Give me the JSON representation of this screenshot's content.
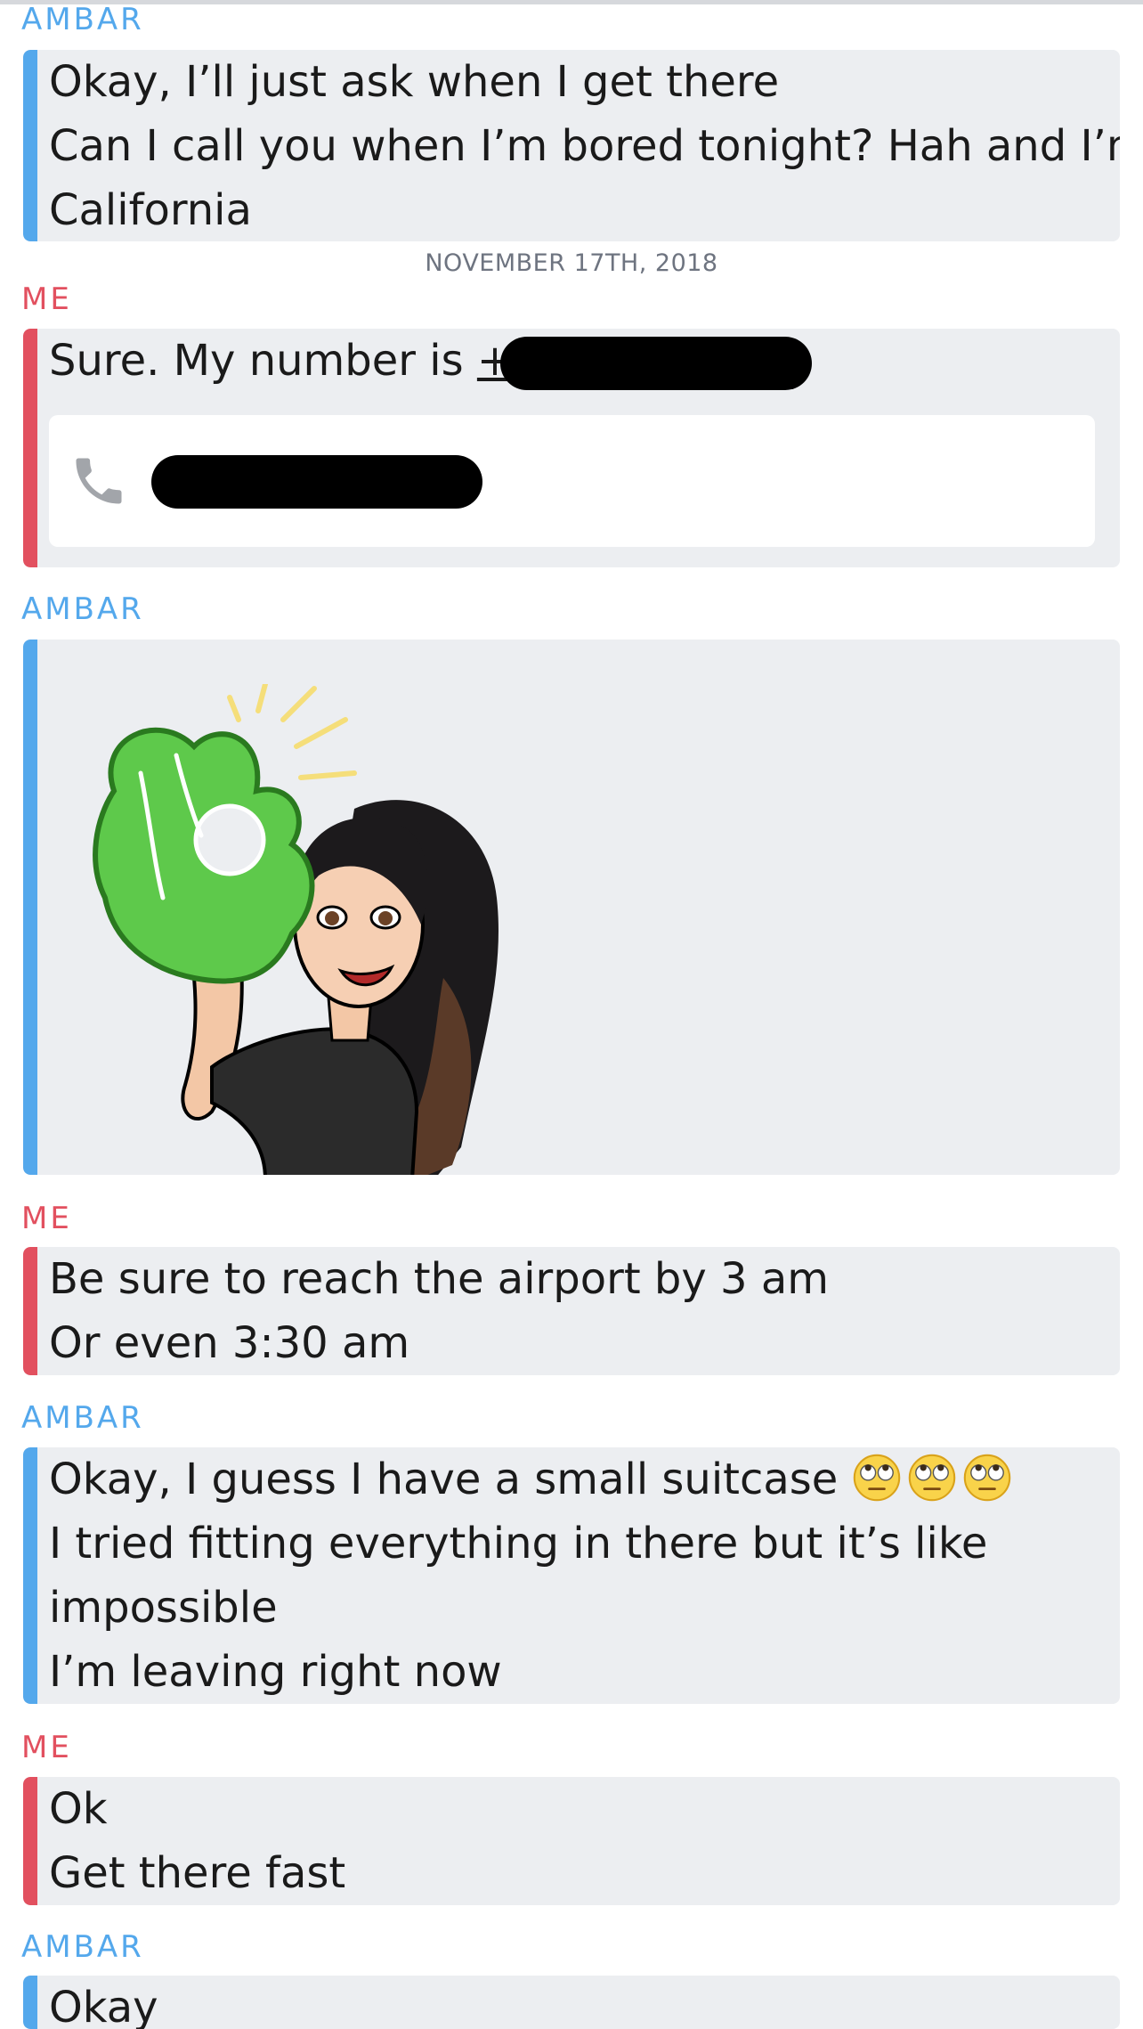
{
  "senders": {
    "ambar": "AMBAR",
    "me": "ME"
  },
  "messages": {
    "m1": {
      "lines": [
        "Okay, I’ll just ask when I get there",
        "Can I call you when I’m bored tonight? Hah and I’m",
        "California"
      ]
    },
    "date_divider": "NOVEMBER 17TH, 2018",
    "m2": {
      "prefix": "Sure. My number is ",
      "plus": "+"
    },
    "m3": {
      "sticker_name": "bitmoji-ok-hand-sticker"
    },
    "m4": {
      "lines": [
        "Be sure to reach the airport by 3 am",
        "Or even 3:30 am"
      ]
    },
    "m5": {
      "line1": "Okay, I guess I have a small suitcase ",
      "emojis": [
        "face-with-rolling-eyes",
        "face-with-rolling-eyes",
        "face-with-rolling-eyes"
      ],
      "lines": [
        "I tried fitting everything in there but it’s like",
        "impossible",
        "I’m leaving right now"
      ]
    },
    "m6": {
      "lines": [
        "Ok",
        "Get there fast"
      ]
    },
    "m7": {
      "lines": [
        "Okay"
      ]
    }
  },
  "colors": {
    "ambar_accent": "#54a8ec",
    "me_accent": "#e2505f",
    "bubble_bg": "#eceef1"
  }
}
